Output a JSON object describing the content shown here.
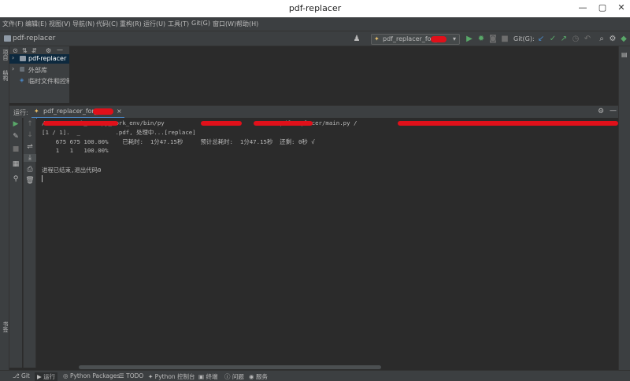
{
  "window": {
    "title": "pdf-replacer",
    "controls": {
      "minimize": "—",
      "maximize": "▢",
      "close": "✕"
    }
  },
  "menu": [
    "文件(F)",
    "编辑(E)",
    "视图(V)",
    "导航(N)",
    "代码(C)",
    "重构(R)",
    "运行(U)",
    "工具(T)",
    "Git(G)",
    "窗口(W)",
    "帮助(H)"
  ],
  "navbar": {
    "breadcrumb": "pdf-replacer",
    "run_config": "pdf_replacer_for_",
    "git_label": "Git(G):"
  },
  "left_stripe": {
    "project_label": "项目",
    "structure_label": "结构",
    "bookmarks_label": "书签"
  },
  "project_tree": [
    {
      "label": "pdf-replacer",
      "selected": true
    },
    {
      "label": "外部库",
      "selected": false
    },
    {
      "label": "临时文件和控制台",
      "selected": false
    }
  ],
  "run_panel": {
    "label": "运行:",
    "tab_label": "pdf_replacer_for_",
    "console_lines": [
      "/          k_env/py_work_env/bin/py           a/                 er/pdf-replacer/main.py /",
      "[1 / 1].  _          .pdf, 处理中...[replace]",
      "    675 675 100.00%    已耗时:  1分47.15秒     预计总耗时:  1分47.15秒  还剩: 0秒 √",
      "    1   1   100.00%",
      "",
      "进程已结束,退出代码0"
    ]
  },
  "statusbar": {
    "items": [
      "Git",
      "运行",
      "Python Packages",
      "TODO",
      "Python 控制台",
      "终端",
      "问题",
      "服务"
    ]
  },
  "colors": {
    "accent": "#4a88c7",
    "run_green": "#59a869",
    "redaction": "#e0101a"
  }
}
